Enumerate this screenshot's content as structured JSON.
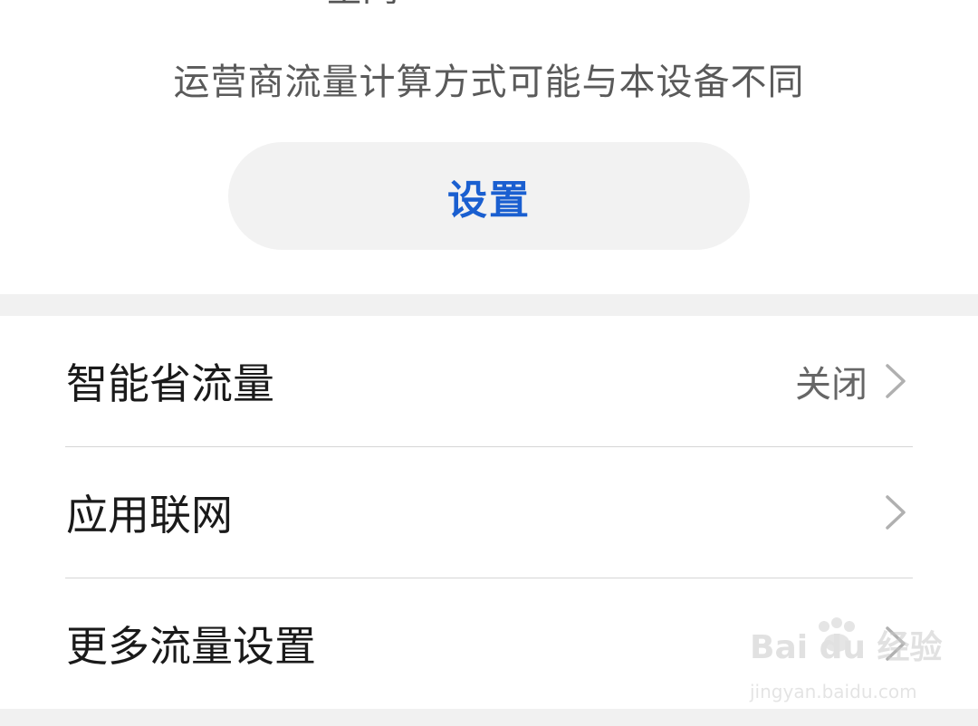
{
  "header": {
    "cut_text": "全网",
    "carrier_note": "运营商流量计算方式可能与本设备不同",
    "settings_button_label": "设置"
  },
  "list": {
    "items": [
      {
        "label": "智能省流量",
        "value": "关闭",
        "icon": "chevron-right-icon"
      },
      {
        "label": "应用联网",
        "value": "",
        "icon": "chevron-right-icon"
      },
      {
        "label": "更多流量设置",
        "value": "",
        "icon": "chevron-right-icon"
      }
    ]
  },
  "watermark": {
    "brand": "Bai du 经验",
    "url": "jingyan.baidu.com"
  },
  "colors": {
    "accent": "#1a5fd0",
    "background": "#f1f1f1",
    "card": "#ffffff"
  }
}
